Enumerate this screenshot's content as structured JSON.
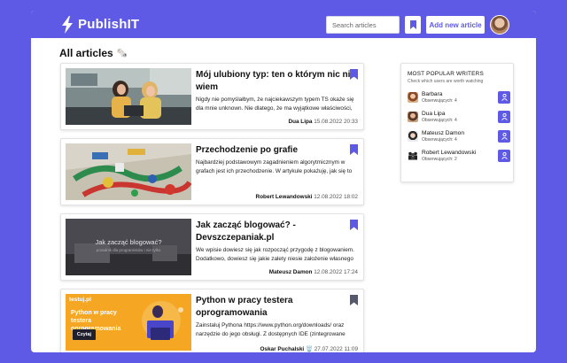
{
  "app": {
    "brand": "PublishIT"
  },
  "header": {
    "search_placeholder": "Search articles",
    "add_button": "Add new article"
  },
  "page": {
    "title": "All articles",
    "title_emoji": "🗞️"
  },
  "articles": [
    {
      "title": "Mój ulubiony typ: ten o którym nic nie wiem",
      "description": "Nigdy nie pomyślałbym, że najciekawszym typem TS okaże się dla mnie unknown. Nie dlatego, że ma wyjątkowe właściwości, czy też mogę",
      "author": "Dua Lipa",
      "date": "15.08.2022 20:33",
      "bookmark_color": "#5f5ae6"
    },
    {
      "title": "Przechodzenie po grafie",
      "description": "Najbardziej podstawowym zagadnieniem algorytmicznym w grafach jest ich przechodzenie. W artykule pokażuję, jak się to robi.",
      "author": "Robert Lewandowski",
      "date": "12.08.2022 18:02",
      "bookmark_color": "#5f5ae6"
    },
    {
      "title": "Jak zacząć blogować? - Devszczepaniak.pl",
      "description": "We wpisie dowiesz się jak rozpocząć przygodę z blogowaniem. Dodatkowo, dowiesz się jakie zalety niesie założenie własnego bloga.",
      "author": "Mateusz Damon",
      "date": "12.08.2022 17:24",
      "bookmark_color": "#5f5ae6",
      "thumb_text_1": "Jak zacząć blogować?",
      "thumb_text_2": "poradnik dla programistów i nie tylko"
    },
    {
      "title": "Python w pracy testera oprogramowania",
      "description": "Zainstaluj Pythona https://www.python.org/downloads/ oraz narzędzie do jego obsługi. Z dostępnych IDE (zintegrowane środowisko",
      "author": "Oskar Puchalski",
      "author_emoji": "🗑️",
      "date": "27.07.2022 11:09",
      "bookmark_color": "#55596b",
      "thumb_brand": "testuj.pl",
      "thumb_heading": "Python w pracy testera oprogramowania",
      "thumb_button": "Czytaj"
    }
  ],
  "sidebar": {
    "title": "MOST POPULAR WRITERS",
    "subtitle": "Check which users are worth watching",
    "writers": [
      {
        "name": "Barbara",
        "followers": "Obserwujących: 4"
      },
      {
        "name": "Dua Lipa",
        "followers": "Obserwujących: 4"
      },
      {
        "name": "Mateusz Damon",
        "followers": "Obserwujących: 4"
      },
      {
        "name": "Robert Lewandowski",
        "followers": "Obserwujących: 2"
      }
    ]
  },
  "colors": {
    "accent": "#5f5ae6",
    "background": "#5f5ae6",
    "muted_bookmark": "#55596b"
  }
}
